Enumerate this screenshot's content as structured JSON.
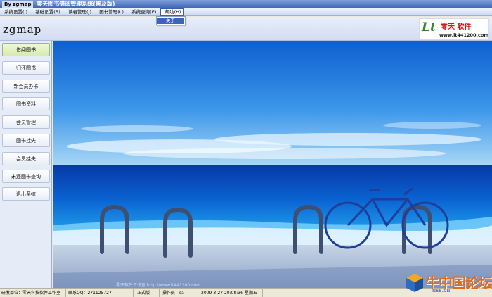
{
  "window": {
    "title_tag": "By zgmap",
    "title": "零天图书借阅管理系统(普及版)"
  },
  "menu": [
    "系统设置(I)",
    "基础设置(B)",
    "读者管理(J)",
    "图书管理(L)",
    "系统查询(E)",
    "帮助(H)"
  ],
  "dropdown": {
    "items": [
      "关于"
    ]
  },
  "header": {
    "app_name": "zgmap"
  },
  "logo": {
    "mark": "Lt",
    "name": "零天 软件",
    "url": "www.lt441200.com"
  },
  "sidebar": {
    "items": [
      {
        "label": "借阅图书",
        "active": true
      },
      {
        "label": "归还图书",
        "active": false
      },
      {
        "label": "新会员办卡",
        "active": false
      },
      {
        "label": "图书资料",
        "active": false
      },
      {
        "label": "会员管理",
        "active": false
      },
      {
        "label": "图书挂失",
        "active": false
      },
      {
        "label": "会员挂失",
        "active": false
      },
      {
        "label": "未还图书查询",
        "active": false
      },
      {
        "label": "退出系统",
        "active": false
      }
    ]
  },
  "content": {
    "watermark": "零天软件工作室 http://www.lt441200.com"
  },
  "status": {
    "developer": "研发单位：零天科技软件工作室",
    "contact": "联系QQ：271125727",
    "edition": "正式版",
    "operator": "操作员：sa",
    "datetime": "2009-3-27 20:08:36 星期五"
  },
  "corner_logo": {
    "brand": "牛中国论坛",
    "sub": "NEB.CN"
  },
  "colors": {
    "accent": "#3b63c4",
    "sky_top": "#1e6fd6",
    "sea": "#0a49b8",
    "logo_red": "#d01818"
  }
}
